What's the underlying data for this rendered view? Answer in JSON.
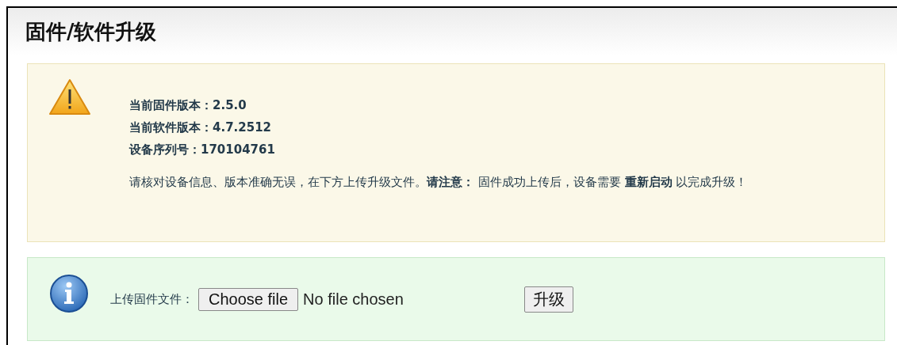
{
  "page_title": "固件/软件升级",
  "warning": {
    "info_lines": [
      {
        "label": "当前固件版本：",
        "value": "2.5.0"
      },
      {
        "label": "当前软件版本：",
        "value": "4.7.2512"
      },
      {
        "label": "设备序列号：",
        "value": "170104761"
      }
    ],
    "notice": "请核对设备信息、版本准确无误，在下方上传升级文件。**请注意：** 固件成功上传后，设备需要 **重新启动** 以完成升级！"
  },
  "upload": {
    "label": "上传固件文件：",
    "choose_button": "Choose file",
    "file_status": "No file chosen",
    "submit_button": "升级"
  }
}
